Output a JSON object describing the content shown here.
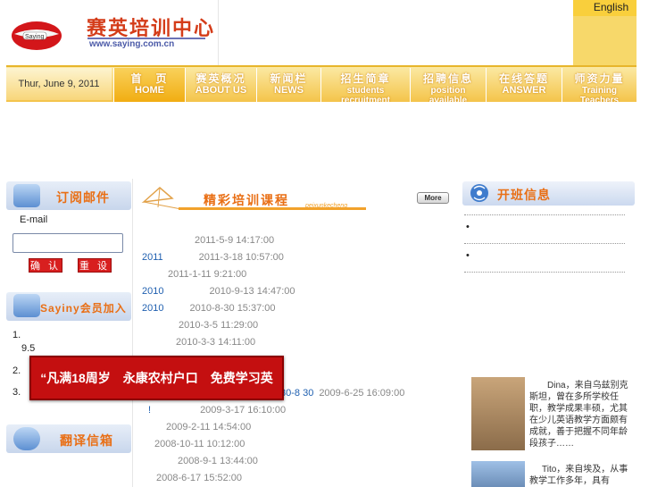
{
  "header": {
    "logo_cn": "赛英培训中心",
    "logo_url": "www.saying.com.cn",
    "logo_badge": "Saying",
    "english_link": "English",
    "date": "Thur, June 9, 2011"
  },
  "nav": [
    {
      "cn": "首　页",
      "en": "HOME"
    },
    {
      "cn": "赛英概况",
      "en": "ABOUT US"
    },
    {
      "cn": "新闻栏",
      "en": "NEWS"
    },
    {
      "cn": "招生简章",
      "en": "students recruitment"
    },
    {
      "cn": "招聘信息",
      "en": "position available"
    },
    {
      "cn": "在线答题",
      "en": "ANSWER"
    },
    {
      "cn": "师资力量",
      "en": "Training Teachers"
    }
  ],
  "left": {
    "subscribe_title": "订阅邮件",
    "email_label": "E-mail",
    "confirm": "确 认",
    "reset": "重 设",
    "join_title": "Sayiny会员加入",
    "join_lines": [
      "1.",
      "9.5",
      "2.",
      "3."
    ],
    "translate_title": "翻译信箱"
  },
  "courses": {
    "title": "精彩培训课程",
    "pinyin": "peixunkecheng",
    "more": "More",
    "rows": [
      {
        "year": "",
        "date": "2011-5-9 14:17:00"
      },
      {
        "year": "2011",
        "date": "2011-3-18 10:57:00"
      },
      {
        "year": "",
        "date": "2011-1-11 9:21:00"
      },
      {
        "year": "2010",
        "date": "2010-9-13 14:47:00"
      },
      {
        "year": "2010",
        "date": "2010-8-30 15:37:00"
      },
      {
        "year": "",
        "date": "2010-3-5 11:29:00"
      },
      {
        "year": "",
        "date": "2010-3-3 14:11:00"
      },
      {
        "year": "30-8 30",
        "date": "2009-6-25 16:09:00"
      },
      {
        "year": "!",
        "date": "2009-3-17 16:10:00"
      },
      {
        "year": "",
        "date": "2009-2-11 14:54:00"
      },
      {
        "year": "",
        "date": "2008-10-11 10:12:00"
      },
      {
        "year": "",
        "date": "2008-9-1 13:44:00"
      },
      {
        "year": "",
        "date": "2008-6-17 15:52:00"
      }
    ]
  },
  "right": {
    "open_title": "开班信息",
    "bullets": [
      "•",
      "•"
    ],
    "teachers": [
      {
        "text": "Dina，来自乌兹别克斯坦，曾在多所学校任职，教学成果丰硕，尤其在少儿英语教学方面颇有成就，善于把握不同年龄段孩子……"
      },
      {
        "text": "Tito，来自埃及，从事教学工作多年，具有"
      }
    ]
  },
  "promo": "“凡满18周岁　永康农村户口　免费学习英语”"
}
